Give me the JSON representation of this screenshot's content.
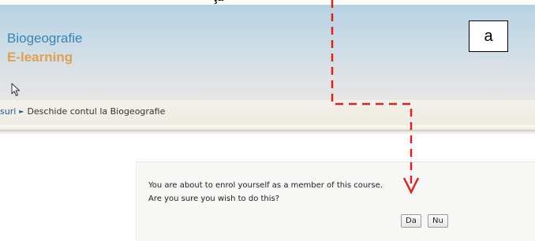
{
  "document": {
    "caption": "ţă"
  },
  "header": {
    "site_title": "Biogeografie",
    "site_subtitle": "E-learning"
  },
  "annotation": {
    "label": "a"
  },
  "breadcrumb": {
    "items": [
      {
        "label": "suri"
      },
      {
        "label": "Deschide contul la Biogeografie"
      }
    ],
    "separator": "►"
  },
  "dialog": {
    "message_line1": "You are about to enrol yourself as a member of this course.",
    "message_line2": "Are you sure you wish to do this?",
    "confirm_label": "Da",
    "cancel_label": "Nu"
  },
  "icons": {
    "cursor": "mouse-pointer-icon",
    "arrow": "dashed-arrow-icon"
  },
  "colors": {
    "title_blue": "#3a85b5",
    "subtitle_orange": "#e0a050",
    "arrow_red": "#e02020",
    "link_blue": "#1a5a96"
  }
}
